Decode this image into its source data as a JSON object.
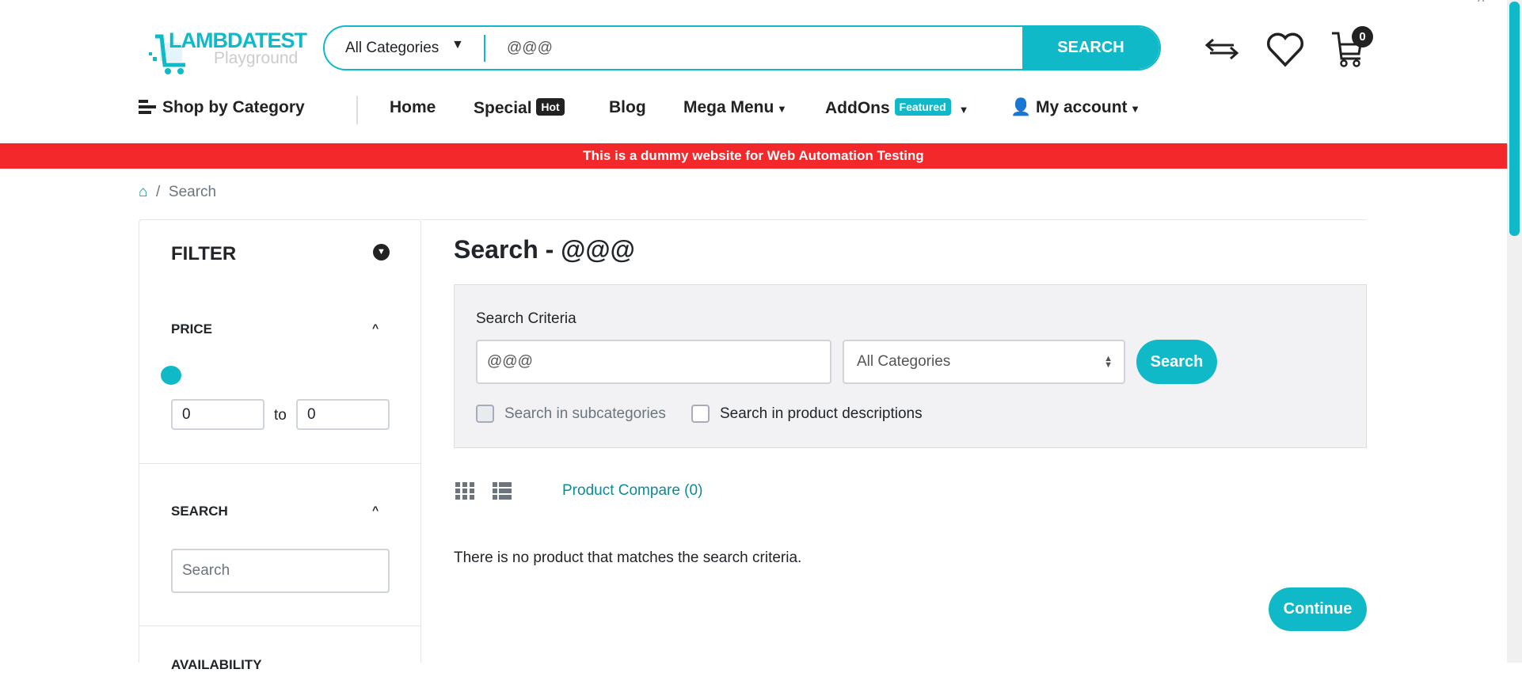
{
  "logo": {
    "brand": "LAMBDATEST",
    "sub": "Playground"
  },
  "header": {
    "category": "All Categories",
    "query": "@@@",
    "search_button": "SEARCH",
    "cart_count": "0"
  },
  "nav": {
    "shop_by_category": "Shop by Category",
    "home": "Home",
    "special": "Special",
    "hot_badge": "Hot",
    "blog": "Blog",
    "mega_menu": "Mega Menu",
    "addons": "AddOns",
    "featured_badge": "Featured",
    "my_account": "My account"
  },
  "banner": "This is a dummy website for Web Automation Testing",
  "breadcrumb": {
    "current": "Search"
  },
  "filter": {
    "title": "FILTER",
    "price": "PRICE",
    "min": "0",
    "to": "to",
    "max": "0",
    "search": "SEARCH",
    "search_placeholder": "Search",
    "availability": "AVAILABILITY"
  },
  "main": {
    "title": "Search - @@@",
    "criteria_label": "Search Criteria",
    "criteria_value": "@@@",
    "category": "All Categories",
    "search_button": "Search",
    "subcategories": "Search in subcategories",
    "descriptions": "Search in product descriptions",
    "compare": "Product Compare (0)",
    "no_results": "There is no product that matches the search criteria.",
    "continue": "Continue"
  },
  "colors": {
    "accent": "#10b9c7",
    "banner": "#f2282b"
  }
}
